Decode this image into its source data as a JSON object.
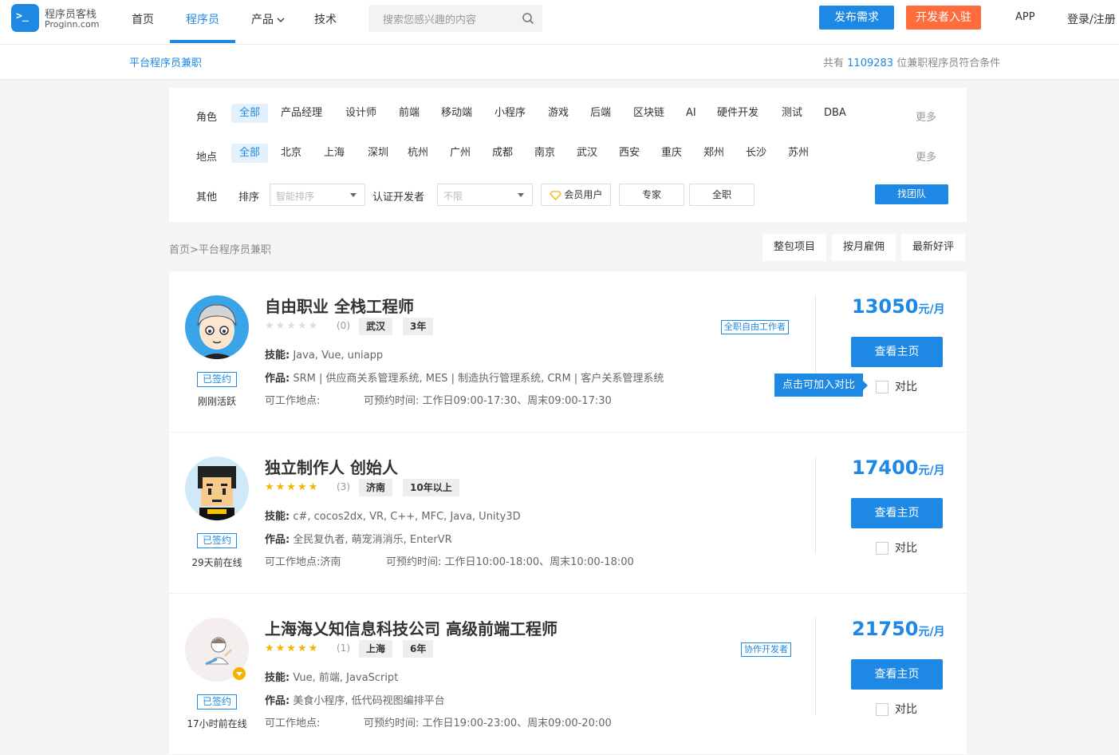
{
  "header": {
    "logo_icon": ">_",
    "logo_cn": "程序员客栈",
    "logo_en": "Proginn.com",
    "nav": [
      "首页",
      "程序员",
      "产品",
      "技术"
    ],
    "search_placeholder": "搜索您感兴趣的内容",
    "publish_label": "发布需求",
    "join_label": "开发者入驻",
    "app_label": "APP",
    "login_label": "登录/注册"
  },
  "subbar": {
    "title": "平台程序员兼职",
    "count_prefix": "共有",
    "count": "1109283",
    "count_suffix": "位兼职程序员符合条件"
  },
  "filters": {
    "role_label": "角色",
    "roles": [
      "全部",
      "产品经理",
      "设计师",
      "前端",
      "移动端",
      "小程序",
      "游戏",
      "后端",
      "区块链",
      "AI",
      "硬件开发",
      "测试",
      "DBA"
    ],
    "location_label": "地点",
    "locations": [
      "全部",
      "北京",
      "上海",
      "深圳",
      "杭州",
      "广州",
      "成都",
      "南京",
      "武汉",
      "西安",
      "重庆",
      "郑州",
      "长沙",
      "苏州"
    ],
    "more": "更多",
    "other_label": "其他",
    "sort_label": "排序",
    "sort_value": "智能排序",
    "cert_label": "认证开发者",
    "cert_value": "不限",
    "member_label": "会员用户",
    "expert_label": "专家",
    "fulltime_label": "全职",
    "team_button": "找团队"
  },
  "breadcrumb": "首页>平台程序员兼职",
  "sort_tabs": [
    "整包项目",
    "按月雇佣",
    "最新好评"
  ],
  "cards": [
    {
      "name": "自由职业 全栈工程师",
      "rating": 0,
      "review_count": "(0)",
      "city": "武汉",
      "experience": "3年",
      "badge": "全职自由工作者",
      "skills_label": "技能:",
      "skills": "Java, Vue, uniapp",
      "works_label": "作品:",
      "works": "SRM | 供应商关系管理系统, MES | 制造执行管理系统, CRM | 客户关系管理系统",
      "location_label": "可工作地点:",
      "location": "",
      "time_label": "可预约时间:",
      "time": "工作日09:00-17:30、周末09:00-17:30",
      "signed": "已签约",
      "activity": "刚刚活跃",
      "price": "13050",
      "price_unit": "元/月",
      "view_button": "查看主页",
      "compare": "对比"
    },
    {
      "name": "独立制作人 创始人",
      "rating": 5,
      "review_count": "(3)",
      "city": "济南",
      "experience": "10年以上",
      "badge": "",
      "skills_label": "技能:",
      "skills": "c#, cocos2dx, VR, C++, MFC, Java, Unity3D",
      "works_label": "作品:",
      "works": "全民复仇者, 萌宠消消乐, EnterVR",
      "location_label": "可工作地点:",
      "location": "济南",
      "time_label": "可预约时间:",
      "time": "工作日10:00-18:00、周末10:00-18:00",
      "signed": "已签约",
      "activity": "29天前在线",
      "price": "17400",
      "price_unit": "元/月",
      "view_button": "查看主页",
      "compare": "对比"
    },
    {
      "name": "上海海乂知信息科技公司 高级前端工程师",
      "rating": 5,
      "review_count": "(1)",
      "city": "上海",
      "experience": "6年",
      "badge": "协作开发者",
      "skills_label": "技能:",
      "skills": "Vue, 前端, JavaScript",
      "works_label": "作品:",
      "works": "美食小程序, 低代码视图编排平台",
      "location_label": "可工作地点:",
      "location": "",
      "time_label": "可预约时间:",
      "time": "工作日19:00-23:00、周末09:00-20:00",
      "signed": "已签约",
      "activity": "17小时前在线",
      "price": "21750",
      "price_unit": "元/月",
      "view_button": "查看主页",
      "compare": "对比"
    }
  ],
  "compare_tip": "点击可加入对比",
  "colors": {
    "primary": "#1e88e5",
    "accent": "#ff6d3f",
    "star": "#f5b301"
  },
  "icons": {
    "search": "search-icon",
    "diamond": "diamond-icon",
    "caret": "caret-down-icon"
  }
}
